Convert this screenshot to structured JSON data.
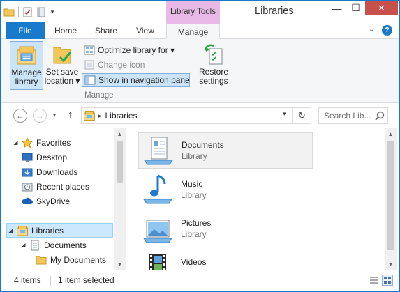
{
  "window": {
    "title": "Libraries",
    "context_tab": "Library Tools",
    "controls": {
      "minimize": "—",
      "maximize": "☐",
      "close": "✕"
    }
  },
  "quick_access": {
    "dropdown": "▾"
  },
  "ribbon_tabs": {
    "file": "File",
    "home": "Home",
    "share": "Share",
    "view": "View",
    "manage": "Manage",
    "expand": "⌄",
    "help": "?"
  },
  "ribbon": {
    "manage_library": [
      "Manage",
      "library"
    ],
    "set_save_location": [
      "Set save",
      "location ▾"
    ],
    "optimize_library_for": "Optimize library for ▾",
    "change_icon": "Change icon",
    "show_in_navigation_pane": "Show in navigation pane",
    "group_label": "Manage",
    "restore_settings": [
      "Restore",
      "settings"
    ]
  },
  "address_bar": {
    "back": "←",
    "forward": "→",
    "history": "▾",
    "up": "↑",
    "chevron": "▸",
    "path": "Libraries",
    "dropdown": "▾",
    "refresh": "↻",
    "search_placeholder": "Search Lib..."
  },
  "nav_tree": {
    "favorites": "Favorites",
    "desktop": "Desktop",
    "downloads": "Downloads",
    "recent_places": "Recent places",
    "skydrive": "SkyDrive",
    "libraries": "Libraries",
    "documents": "Documents",
    "my_documents": "My Documents",
    "expanded_arrow": "◢",
    "collapsed_arrow": "▷"
  },
  "libraries": [
    {
      "name": "Documents",
      "type": "Library",
      "icon": "documents-library-icon"
    },
    {
      "name": "Music",
      "type": "Library",
      "icon": "music-library-icon"
    },
    {
      "name": "Pictures",
      "type": "Library",
      "icon": "pictures-library-icon"
    },
    {
      "name": "Videos",
      "type": "Library",
      "icon": "videos-library-icon"
    }
  ],
  "scrollbar": {
    "up": "▲",
    "down": "▼"
  },
  "status": {
    "item_count": "4 items",
    "selection": "1 item selected"
  },
  "colors": {
    "accent": "#1979ca",
    "context_tab": "#e8b9e6",
    "selection": "#cce8ff",
    "close_button": "#c7504b"
  }
}
